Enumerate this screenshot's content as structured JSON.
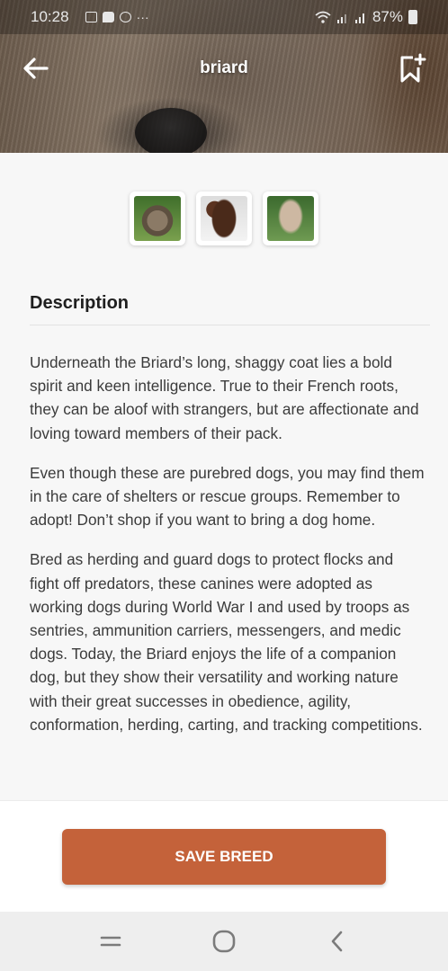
{
  "status_bar": {
    "time": "10:28",
    "more_indicator": "···",
    "battery_percent": "87%",
    "icons": [
      "gallery-icon",
      "message-icon",
      "whatsapp-icon",
      "wifi-icon",
      "signal-icon",
      "signal-icon",
      "battery-charging-icon"
    ]
  },
  "appbar": {
    "title": "briard",
    "back_icon": "arrow-left-icon",
    "bookmark_icon": "bookmark-add-icon"
  },
  "thumbnails": [
    {
      "name": "briard-photo-1"
    },
    {
      "name": "briard-photo-2"
    },
    {
      "name": "briard-photo-3"
    }
  ],
  "description": {
    "heading": "Description",
    "paragraphs": [
      "Underneath the Briard’s long, shaggy coat lies a bold spirit and keen intelligence. True to their French roots, they can be aloof with strangers, but are affectionate and loving toward members of their pack.",
      "Even though these are purebred dogs, you may find them in the care of shelters or rescue groups. Remember to adopt! Don’t shop if you want to bring a dog home.",
      "Bred as herding and guard dogs to protect flocks and fight off predators, these canines were adopted as working dogs during World War I and used by troops as sentries, ammunition carriers, messengers, and medic dogs. Today, the Briard enjoys the life of a companion dog, but they show their versatility and working nature with their great successes in obedience, agility, conformation, herding, carting, and tracking competitions."
    ]
  },
  "footer": {
    "save_label": "SAVE BREED"
  },
  "colors": {
    "accent": "#c4623a"
  },
  "navbar": {
    "icons": [
      "recent-apps-icon",
      "home-icon",
      "back-chevron-icon"
    ]
  }
}
